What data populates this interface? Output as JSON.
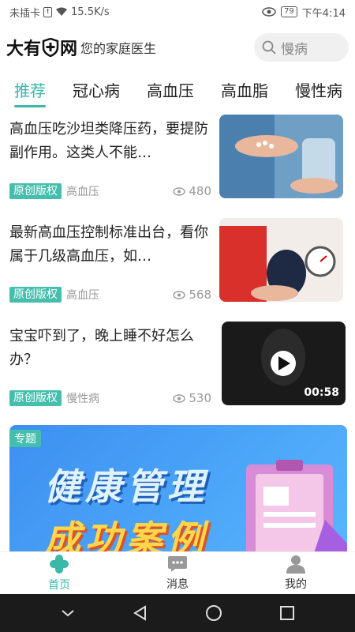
{
  "status_bar": {
    "carrier": "未插卡",
    "sim_icon": "sim-alert-icon",
    "speed": "15.5K/s",
    "battery": "79",
    "time": "下午4:14"
  },
  "header": {
    "logo_part1": "大有",
    "logo_part2": "网",
    "slogan": "您的家庭医生",
    "search_placeholder": "慢病"
  },
  "tabs": [
    {
      "label": "推荐",
      "active": true
    },
    {
      "label": "冠心病",
      "active": false
    },
    {
      "label": "高血压",
      "active": false
    },
    {
      "label": "高血脂",
      "active": false
    },
    {
      "label": "慢性病",
      "active": false
    }
  ],
  "articles": [
    {
      "title": "高血压吃沙坦类降压药，要提防副作用。这类人不能…",
      "badge": "原创版权",
      "tag": "高血压",
      "views": "480",
      "thumb": "pills-hand"
    },
    {
      "title": "最新高血压控制标准出台，看你属于几级高血压，如…",
      "badge": "原创版权",
      "tag": "高血压",
      "views": "568",
      "thumb": "blood-pressure"
    },
    {
      "title": "宝宝吓到了，晚上睡不好怎么办？",
      "badge": "原创版权",
      "tag": "慢性病",
      "views": "530",
      "thumb": "video",
      "duration": "00:58"
    }
  ],
  "banner": {
    "badge": "专题",
    "line1": "健康管理",
    "line2": "成功案例"
  },
  "bottom_nav": [
    {
      "label": "首页",
      "icon": "home-cross-icon",
      "active": true
    },
    {
      "label": "消息",
      "icon": "message-icon",
      "active": false
    },
    {
      "label": "我的",
      "icon": "profile-icon",
      "active": false
    }
  ],
  "colors": {
    "accent": "#3ab8a8",
    "badge": "#44bfae",
    "banner_blue": "#4aa3f7",
    "banner_yellow": "#ffd64a"
  }
}
